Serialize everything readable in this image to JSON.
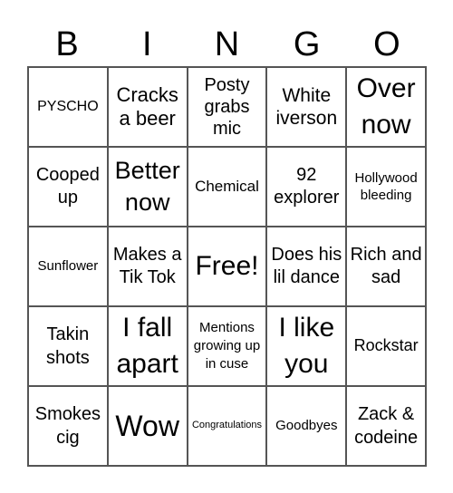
{
  "header": {
    "letters": [
      "B",
      "I",
      "N",
      "G",
      "O"
    ]
  },
  "cells": [
    "PYSCHO",
    "Cracks a beer",
    "Posty grabs mic",
    "White iverson",
    "Over now",
    "Cooped up",
    "Better now",
    "Chemical",
    "92 explorer",
    "Hollywood bleeding",
    "Sunflower",
    "Makes a Tik Tok",
    "Free!",
    "Does his lil dance",
    "Rich and sad",
    "Takin shots",
    "I fall apart",
    "Mentions growing up in cuse",
    "I like you",
    "Rockstar",
    "Smokes cig",
    "Wow",
    "Congratulations",
    "Goodbyes",
    "Zack & codeine"
  ]
}
